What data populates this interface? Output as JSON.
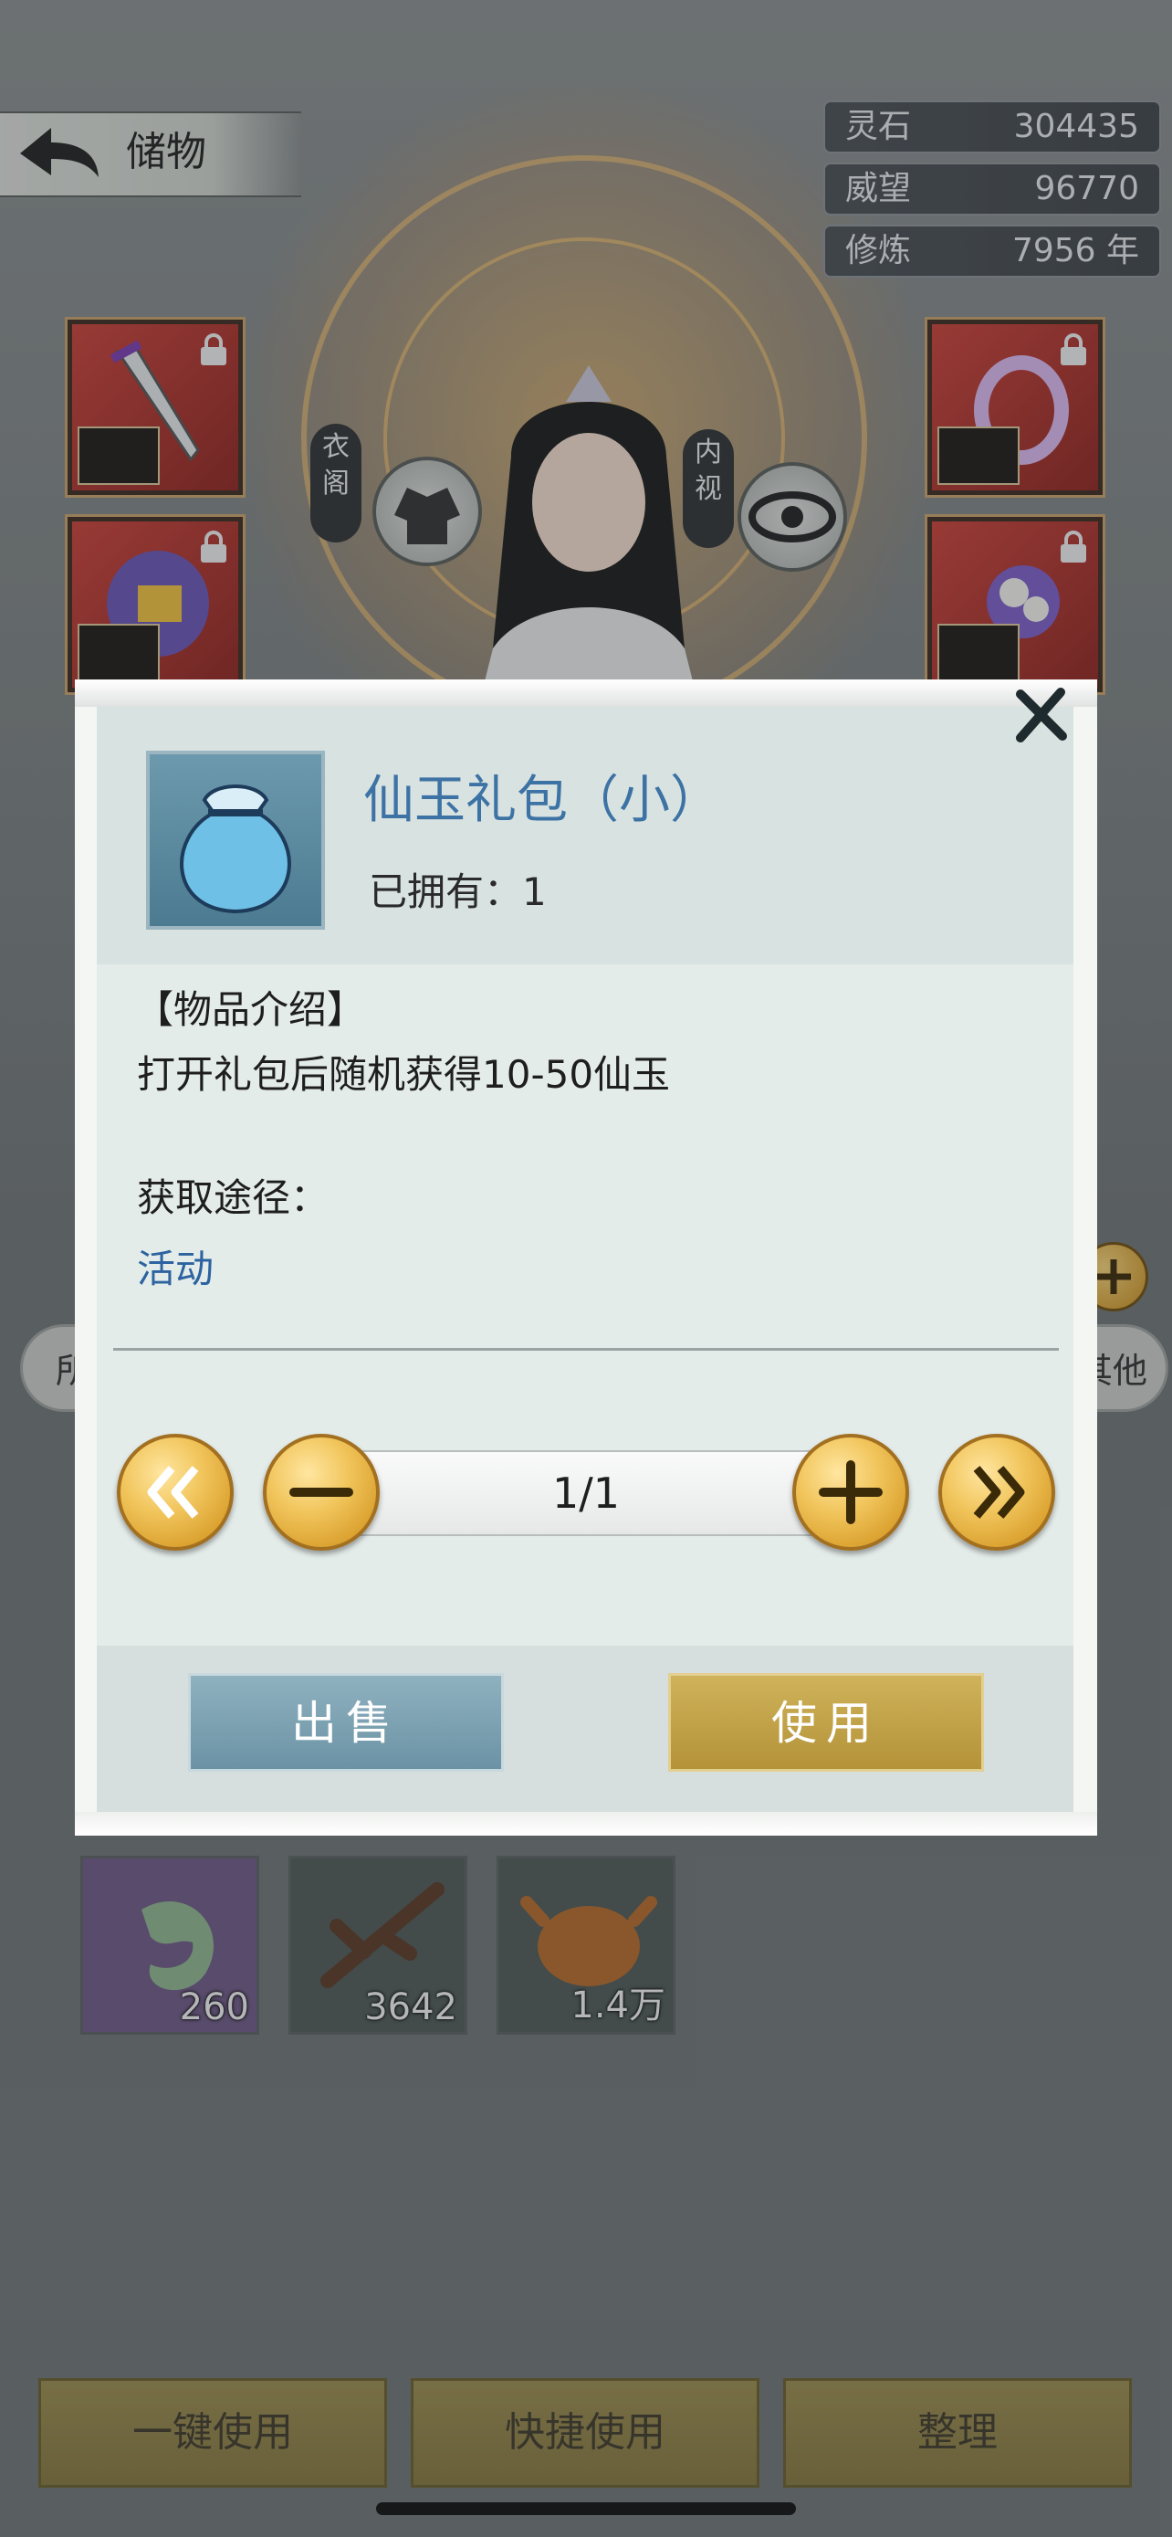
{
  "header": {
    "title": "储物"
  },
  "stats": [
    {
      "label": "灵石",
      "value": "304435"
    },
    {
      "label": "威望",
      "value": "96770"
    },
    {
      "label": "修炼",
      "value": "7956 年"
    }
  ],
  "equipment": {
    "left_tag": "衣阁",
    "right_tag": "内视"
  },
  "tabs": {
    "first": "所",
    "last": "其他"
  },
  "inventory_items": [
    {
      "name": "jade-item",
      "qty": "260"
    },
    {
      "name": "branch-item",
      "qty": "3642"
    },
    {
      "name": "roast-chicken-item",
      "qty": "1.4万"
    }
  ],
  "bottom_bar": {
    "use_all": "一键使用",
    "quick_use": "快捷使用",
    "sort": "整理"
  },
  "dialog": {
    "item_name": "仙玉礼包（小）",
    "owned": "已拥有：1",
    "section_title": "【物品介绍】",
    "description": "打开礼包后随机获得10-50仙玉",
    "acquire_label": "获取途径：",
    "acquire_link": "活动",
    "quantity": "1/1",
    "sell_label": "出售",
    "use_label": "使用"
  },
  "colors": {
    "title_blue": "#3d73a4",
    "link_blue": "#2d63a0",
    "gold": "#f1c55c",
    "sell_blue": "#7ba0b1",
    "use_gold": "#c4a34a"
  }
}
